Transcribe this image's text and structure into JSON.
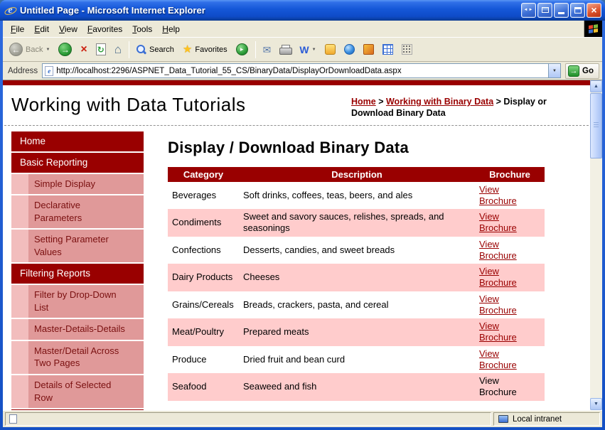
{
  "window": {
    "title": "Untitled Page - Microsoft Internet Explorer"
  },
  "menu": {
    "items": [
      "File",
      "Edit",
      "View",
      "Favorites",
      "Tools",
      "Help"
    ]
  },
  "toolbar": {
    "back_label": "Back",
    "search_label": "Search",
    "favorites_label": "Favorites",
    "word_label": "W"
  },
  "address": {
    "label": "Address",
    "value": "http://localhost:2296/ASPNET_Data_Tutorial_55_CS/BinaryData/DisplayOrDownloadData.aspx",
    "go_label": "Go"
  },
  "status": {
    "zone": "Local intranet"
  },
  "icons": {
    "back": "←",
    "forward": "→",
    "stop": "×",
    "refresh": "↻",
    "home": "⌂",
    "favorites_star": "★",
    "media_play": "▸",
    "mail": "✉",
    "dropdown": "▼",
    "go_arrow": "→",
    "close": "×",
    "nav_left": "◄",
    "nav_right": "►",
    "scroll_up": "▲",
    "scroll_down": "▼",
    "ie_e": "e"
  },
  "page": {
    "site_title": "Working with Data Tutorials",
    "breadcrumb_sep": ">",
    "breadcrumb": [
      {
        "label": "Home",
        "link": true
      },
      {
        "label": "Working with Binary Data",
        "link": true
      },
      {
        "label": "Display or Download Binary Data",
        "link": false
      }
    ],
    "heading": "Display / Download Binary Data",
    "sidebar": [
      {
        "label": "Home",
        "type": "header"
      },
      {
        "label": "Basic Reporting",
        "type": "header"
      },
      {
        "label": "Simple Display",
        "type": "item"
      },
      {
        "label": "Declarative Parameters",
        "type": "item"
      },
      {
        "label": "Setting Parameter Values",
        "type": "item"
      },
      {
        "label": "Filtering Reports",
        "type": "header"
      },
      {
        "label": "Filter by Drop-Down List",
        "type": "item"
      },
      {
        "label": "Master-Details-Details",
        "type": "item"
      },
      {
        "label": "Master/Detail Across Two Pages",
        "type": "item"
      },
      {
        "label": "Details of Selected Row",
        "type": "item"
      }
    ],
    "table": {
      "headers": [
        "Category",
        "Description",
        "Brochure"
      ],
      "rows": [
        {
          "category": "Beverages",
          "description": "Soft drinks, coffees, teas, beers, and ales",
          "brochure": "View Brochure",
          "link": true
        },
        {
          "category": "Condiments",
          "description": "Sweet and savory sauces, relishes, spreads, and seasonings",
          "brochure": "View Brochure",
          "link": true
        },
        {
          "category": "Confections",
          "description": "Desserts, candies, and sweet breads",
          "brochure": "View Brochure",
          "link": true
        },
        {
          "category": "Dairy Products",
          "description": "Cheeses",
          "brochure": "View Brochure",
          "link": true
        },
        {
          "category": "Grains/Cereals",
          "description": "Breads, crackers, pasta, and cereal",
          "brochure": "View Brochure",
          "link": true
        },
        {
          "category": "Meat/Poultry",
          "description": "Prepared meats",
          "brochure": "View Brochure",
          "link": true
        },
        {
          "category": "Produce",
          "description": "Dried fruit and bean curd",
          "brochure": "View Brochure",
          "link": true
        },
        {
          "category": "Seafood",
          "description": "Seaweed and fish",
          "brochure": "View Brochure",
          "link": false
        }
      ]
    }
  },
  "colors": {
    "maroon": "#990000",
    "chrome": "#ECE9D8",
    "sidebar_item": "#E09999",
    "sidebar_gutter": "#F2BDBD",
    "row_alt": "#FFCCCC"
  }
}
